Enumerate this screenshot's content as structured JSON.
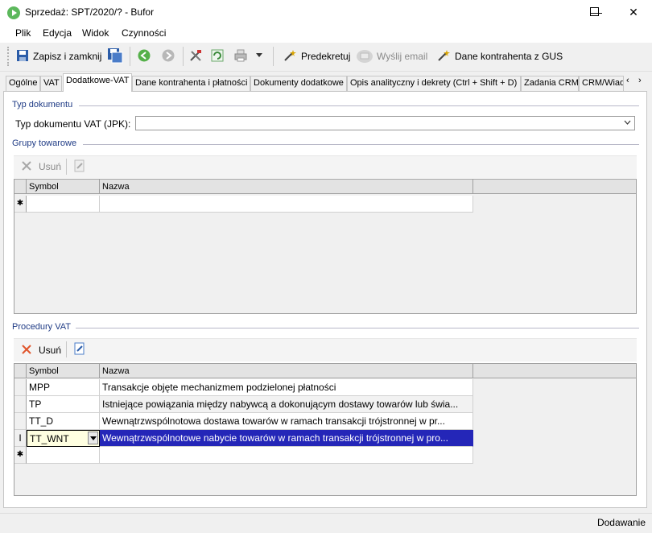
{
  "window": {
    "title": "Sprzedaż: SPT/2020/? - Bufor",
    "minimize_glyph": "—",
    "maximize_glyph": "☐",
    "close_glyph": "✕"
  },
  "menu": {
    "items": [
      "Plik",
      "Edycja",
      "Widok",
      "Czynności"
    ]
  },
  "toolbar": {
    "save_close": "Zapisz i zamknij",
    "predekretuj": "Predekretuj",
    "send_email": "Wyślij email",
    "gus": "Dane kontrahenta z GUS"
  },
  "tabs": [
    "Ogólne",
    "VAT",
    "Dodatkowe-VAT",
    "Dane kontrahenta i płatności",
    "Dokumenty dodatkowe",
    "Opis analityczny i dekrety (Ctrl + Shift + D)",
    "Zadania CRM",
    "CRM/Wiad"
  ],
  "active_tab": "Dodatkowe-VAT",
  "doc_type_section": {
    "title": "Typ dokumentu",
    "field_label": "Typ dokumentu VAT (JPK):",
    "field_value": ""
  },
  "product_groups": {
    "title": "Grupy towarowe",
    "remove_label": "Usuń",
    "columns": [
      "Symbol",
      "Nazwa"
    ],
    "new_row_marker": "✱"
  },
  "vat_procedures": {
    "title": "Procedury VAT",
    "remove_label": "Usuń",
    "columns": [
      "Symbol",
      "Nazwa"
    ],
    "rows": [
      {
        "symbol": "MPP",
        "name": "Transakcje objęte mechanizmem podzielonej płatności"
      },
      {
        "symbol": "TP",
        "name": "Istniejące powiązania między nabywcą a dokonującym dostawy towarów lub świa..."
      },
      {
        "symbol": "TT_D",
        "name": "Wewnątrzwspólnotowa dostawa towarów w ramach transakcji trójstronnej w pr..."
      },
      {
        "symbol": "TT_WNT",
        "name": "Wewnątrzwspólnotowe nabycie towarów w ramach transakcji trójstronnej w pro..."
      }
    ],
    "editing_marker": "I",
    "new_row_marker": "✱"
  },
  "status": {
    "mode": "Dodawanie"
  },
  "colors": {
    "selection": "#2426b8",
    "group_title": "#1f3b85",
    "edit_cell": "#ffffe1"
  }
}
